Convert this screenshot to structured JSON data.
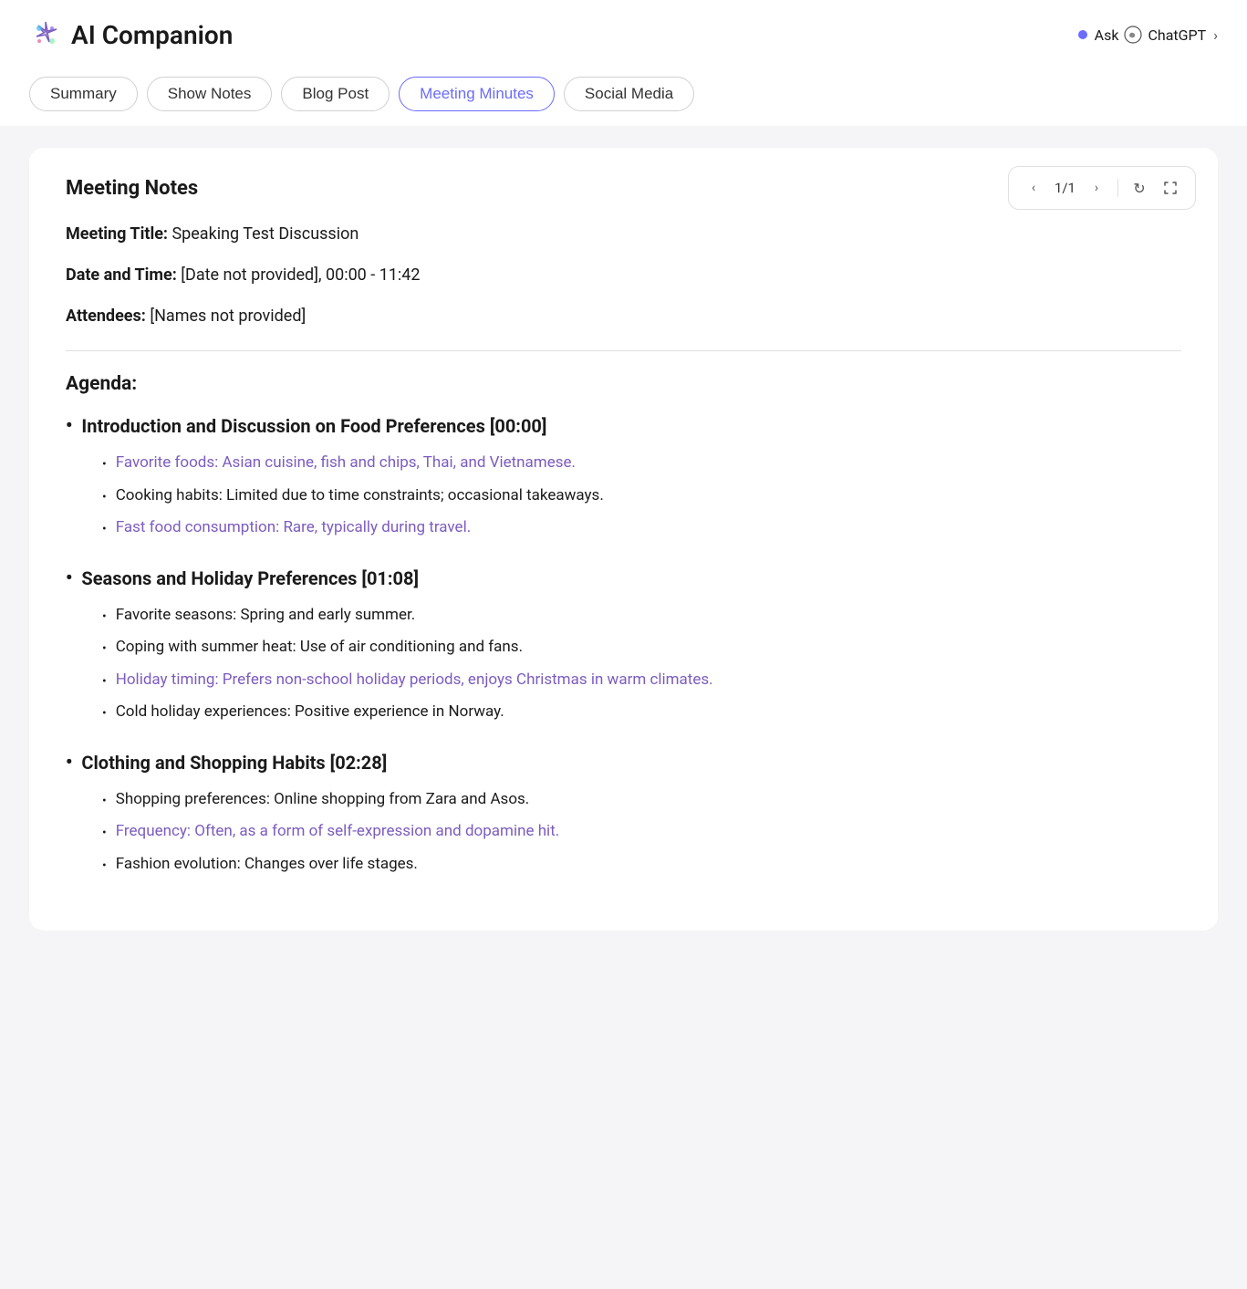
{
  "header": {
    "logo_alt": "AI Companion logo",
    "title": "AI Companion",
    "ask_chatgpt_label": "Ask",
    "chatgpt_label": "ChatGPT"
  },
  "tabs": [
    {
      "id": "summary",
      "label": "Summary",
      "active": false
    },
    {
      "id": "show-notes",
      "label": "Show Notes",
      "active": false
    },
    {
      "id": "blog-post",
      "label": "Blog Post",
      "active": false
    },
    {
      "id": "meeting-minutes",
      "label": "Meeting Minutes",
      "active": true
    },
    {
      "id": "social-media",
      "label": "Social Media",
      "active": false
    }
  ],
  "pagination": {
    "current": "1/1"
  },
  "meeting_notes": {
    "section_title": "Meeting Notes",
    "meeting_title_label": "Meeting Title:",
    "meeting_title_value": "Speaking Test Discussion",
    "date_label": "Date and Time:",
    "date_value": "[Date not provided], 00:00 - 11:42",
    "attendees_label": "Attendees:",
    "attendees_value": "[Names not provided]",
    "agenda_title": "Agenda:",
    "agenda_items": [
      {
        "title": "Introduction and Discussion on Food Preferences [00:00]",
        "sub_items": [
          {
            "text": "Favorite foods: Asian cuisine, fish and chips, Thai, and Vietnamese.",
            "purple": true
          },
          {
            "text": "Cooking habits: Limited due to time constraints; occasional takeaways.",
            "purple": false
          },
          {
            "text": "Fast food consumption: Rare, typically during travel.",
            "purple": true
          }
        ]
      },
      {
        "title": "Seasons and Holiday Preferences [01:08]",
        "sub_items": [
          {
            "text": "Favorite seasons: Spring and early summer.",
            "purple": false
          },
          {
            "text": "Coping with summer heat: Use of air conditioning and fans.",
            "purple": false
          },
          {
            "text": "Holiday timing: Prefers non-school holiday periods, enjoys Christmas in warm climates.",
            "purple": true
          },
          {
            "text": "Cold holiday experiences: Positive experience in Norway.",
            "purple": false
          }
        ]
      },
      {
        "title": "Clothing and Shopping Habits [02:28]",
        "sub_items": [
          {
            "text": "Shopping preferences: Online shopping from Zara and Asos.",
            "purple": false
          },
          {
            "text": "Frequency: Often, as a form of self-expression and dopamine hit.",
            "purple": true
          },
          {
            "text": "Fashion evolution: Changes over life stages.",
            "purple": false
          }
        ]
      }
    ]
  }
}
